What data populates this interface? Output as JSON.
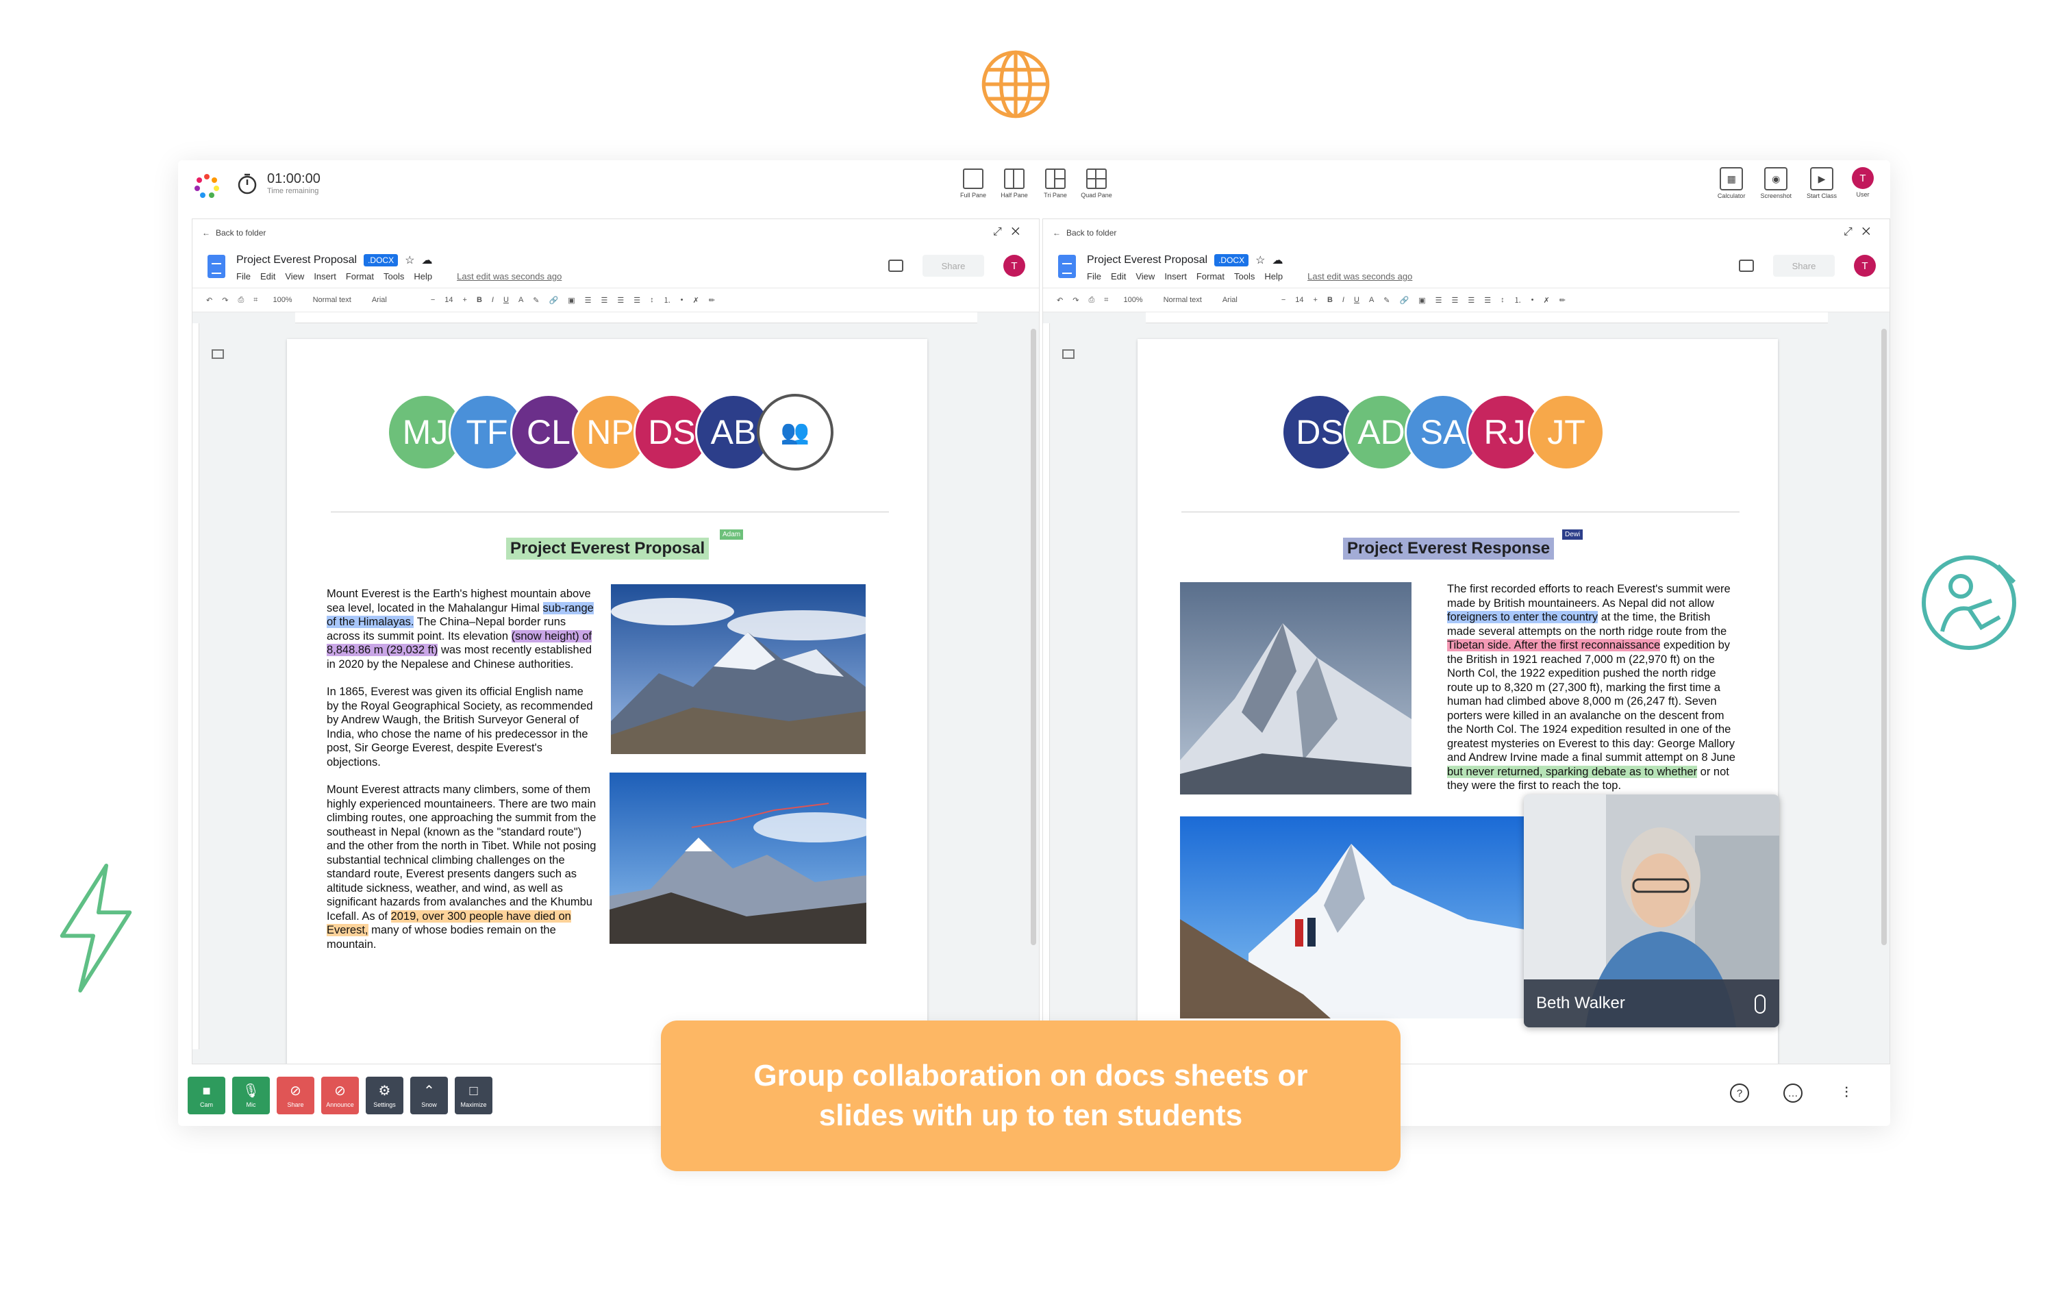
{
  "app": {
    "timer": {
      "value": "01:00:00",
      "label": "Time remaining"
    },
    "panes": [
      "Full Pane",
      "Half Pane",
      "Tri Pane",
      "Quad Pane"
    ],
    "tools": [
      "Calculator",
      "Screenshot",
      "Start Class",
      "User"
    ],
    "user_initial": "T"
  },
  "left_doc": {
    "back": "Back to folder",
    "title": "Project Everest Proposal",
    "badge": ".DOCX",
    "menus": [
      "File",
      "Edit",
      "View",
      "Insert",
      "Format",
      "Tools",
      "Help"
    ],
    "last_edit": "Last edit was seconds ago",
    "share": "Share",
    "toolbar": {
      "zoom": "100%",
      "style": "Normal text",
      "font": "Arial",
      "size": "14"
    },
    "avatars": [
      {
        "initials": "MJ",
        "color": "#6dc07a"
      },
      {
        "initials": "TF",
        "color": "#4a90d9"
      },
      {
        "initials": "CL",
        "color": "#6b2f8a"
      },
      {
        "initials": "NP",
        "color": "#f7a84a"
      },
      {
        "initials": "DS",
        "color": "#c7255e"
      },
      {
        "initials": "AB",
        "color": "#2c3e8a"
      }
    ],
    "heading": "Project Everest Proposal",
    "cursor_name": "Adam",
    "p1_a": "Mount Everest is the Earth's highest mountain above sea level, located in the Mahalangur Himal ",
    "p1_hl1": "sub-range of the Himalayas.",
    "p1_b": " The China–Nepal border runs across its summit point. Its elevation ",
    "p1_hl2": "(snow height) of 8,848.86 m (29,032 ft)",
    "p1_c": " was most recently established in 2020 by the Nepalese and Chinese authorities.",
    "p2": "In 1865, Everest was given its official English name by the Royal Geographical Society, as recommended by Andrew Waugh, the British Surveyor General of India, who chose the name of his predecessor in the post, Sir George Everest, despite Everest's objections.",
    "p3_a": "Mount Everest attracts many climbers, some of them highly experienced mountaineers. There are two main climbing routes, one approaching the summit from the southeast in Nepal (known as the \"standard route\") and the other from the north in Tibet. While not posing substantial technical climbing challenges on the standard route, Everest presents dangers such as altitude sickness, weather, and wind, as well as significant hazards from avalanches and the Khumbu Icefall. As of ",
    "p3_hl": "2019, over 300 people have died on Everest,",
    "p3_b": " many of whose bodies remain on the mountain."
  },
  "right_doc": {
    "back": "Back to folder",
    "title": "Project Everest Proposal",
    "badge": ".DOCX",
    "menus": [
      "File",
      "Edit",
      "View",
      "Insert",
      "Format",
      "Tools",
      "Help"
    ],
    "last_edit": "Last edit was seconds ago",
    "share": "Share",
    "toolbar": {
      "zoom": "100%",
      "style": "Normal text",
      "font": "Arial",
      "size": "14"
    },
    "avatars": [
      {
        "initials": "DS",
        "color": "#2c3e8a"
      },
      {
        "initials": "AD",
        "color": "#6dc07a"
      },
      {
        "initials": "SA",
        "color": "#4a90d9"
      },
      {
        "initials": "RJ",
        "color": "#c7255e"
      },
      {
        "initials": "JT",
        "color": "#f7a84a"
      }
    ],
    "heading": "Project Everest Response",
    "cursor_name": "Dewi",
    "t_a": "The first recorded efforts to reach Everest's summit were made by British mountaineers. As Nepal did not allow ",
    "t_hl1": "foreigners to enter the country",
    "t_b": " at the time, the British made several attempts on the north ridge route from the ",
    "t_hl2": "Tibetan side. After the first reconnaissance",
    "t_c": " expedition by the British in 1921 reached 7,000 m (22,970 ft) on the North Col, the 1922 expedition pushed the north ridge route up to 8,320 m (27,300 ft), marking the first time a human had climbed above 8,000 m (26,247 ft). Seven porters were killed in an avalanche on the descent from the North Col. The 1924 expedition resulted in one of the greatest mysteries on Everest to this day: George Mallory and Andrew Irvine made a final summit attempt on 8 June ",
    "t_hl3": "but never returned, sparking debate as to whether",
    "t_d": " or not they were the first to reach the top."
  },
  "video": {
    "name": "Beth Walker"
  },
  "controls": [
    "Cam",
    "Mic",
    "Share",
    "Announce",
    "Settings",
    "Snow",
    "Maximize"
  ],
  "banner": "Group collaboration on docs sheets or slides with up to ten students"
}
